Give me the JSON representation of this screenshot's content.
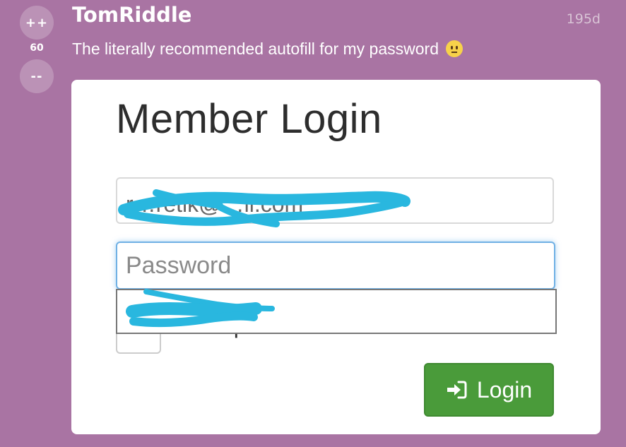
{
  "rant": {
    "upvote_label": "++",
    "downvote_label": "--",
    "score": "60",
    "username": "TomRiddle",
    "age": "195d",
    "text": "The literally recommended autofill for my password",
    "emoji": "slightly-unhappy-face-emoji"
  },
  "screenshot": {
    "title": "Member Login",
    "email_value": "r…retik@…il.com",
    "password_placeholder": "Password",
    "autofill_suggestion": "",
    "hide_password_label": "Hide password",
    "login_label": "Login",
    "login_icon": "sign-in-icon",
    "colors": {
      "scribble": "#29b7df",
      "login_button": "#4a9b3a",
      "focus_border": "#6fb0e4"
    }
  }
}
